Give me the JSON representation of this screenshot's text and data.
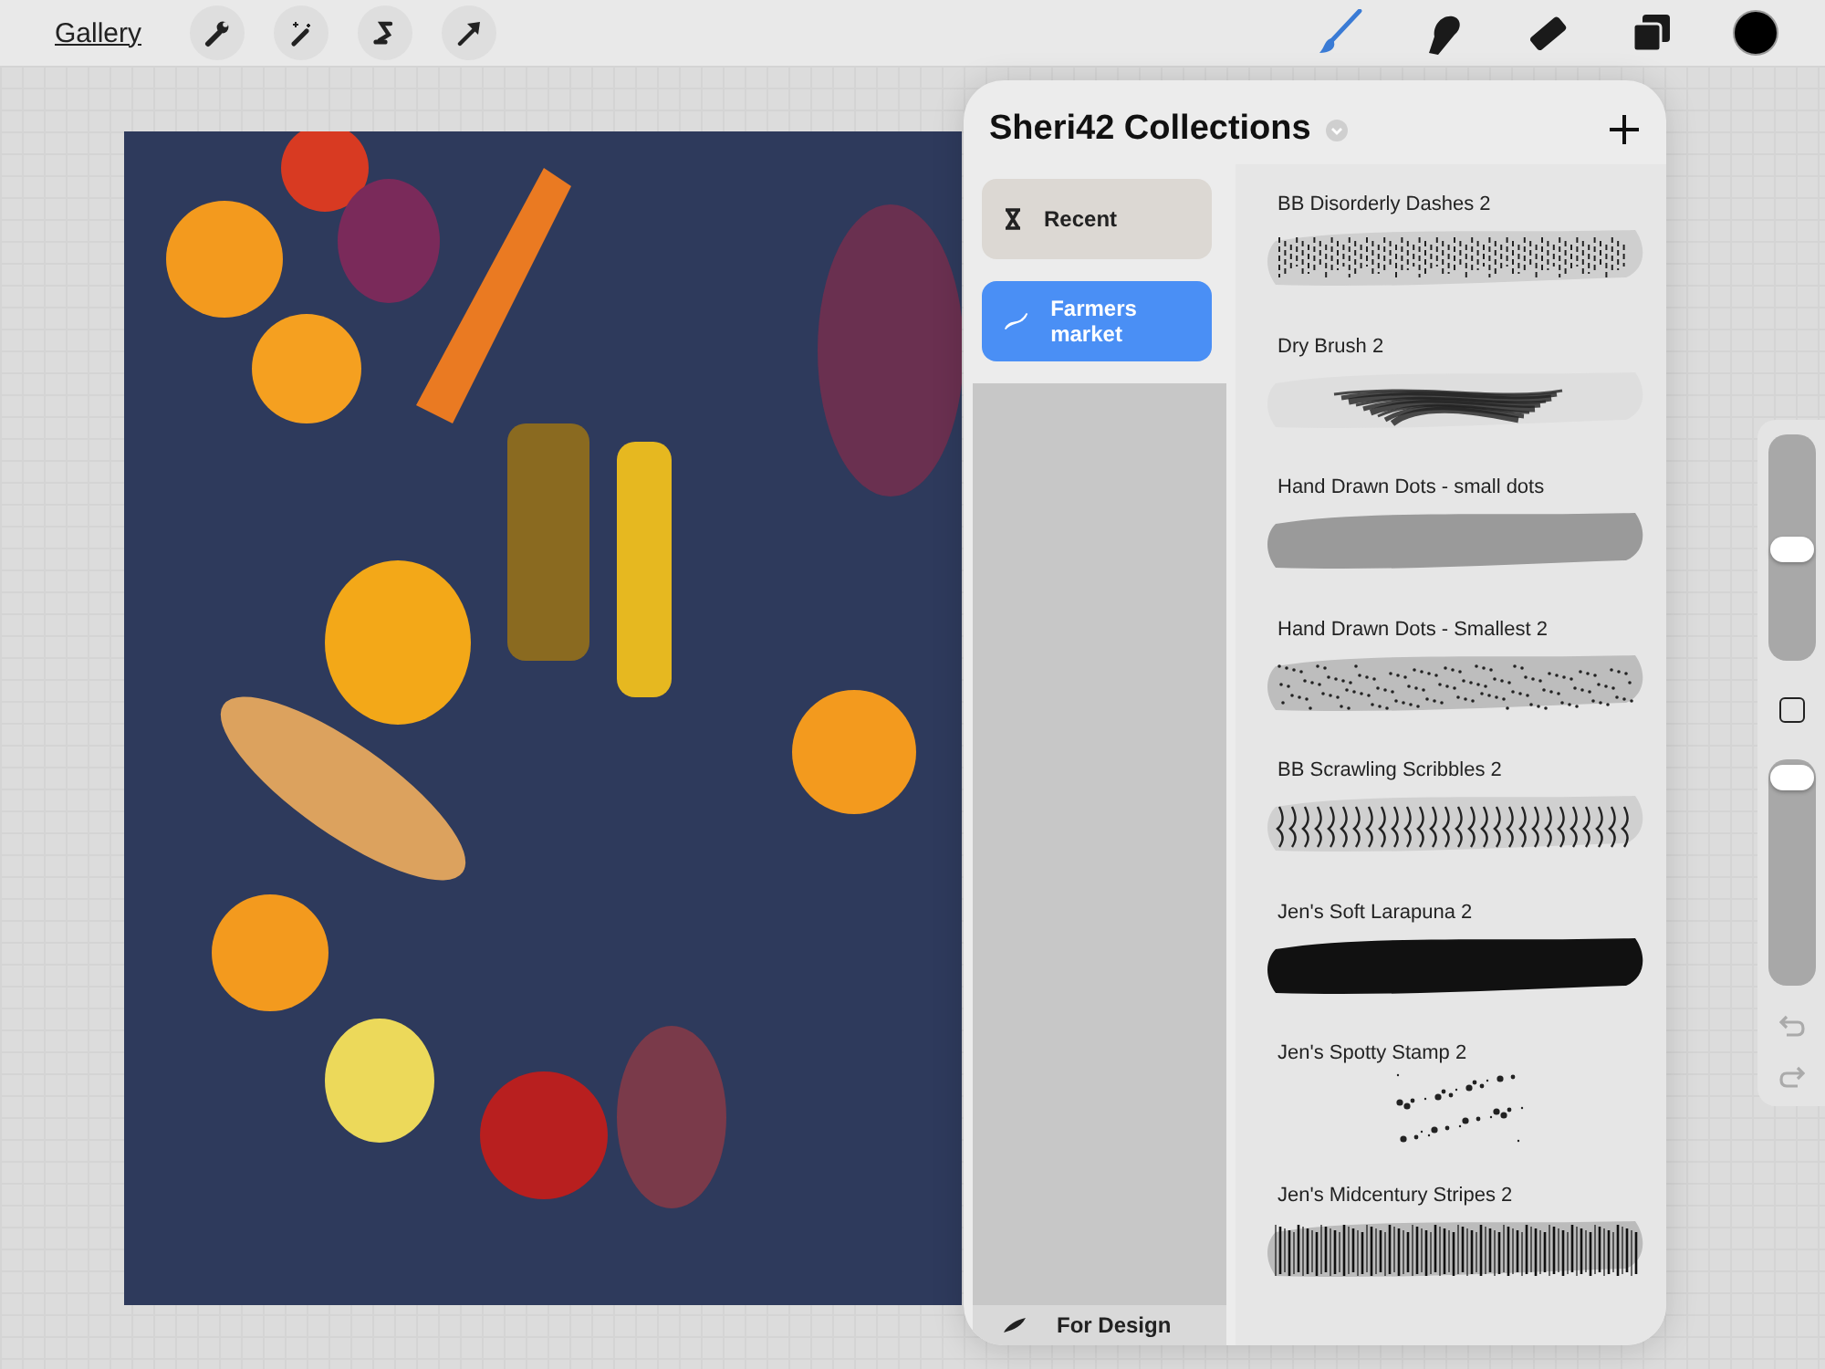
{
  "toolbar": {
    "gallery_link": "Gallery",
    "left_tools": [
      {
        "kind": "wrench"
      },
      {
        "kind": "wand"
      },
      {
        "kind": "selection"
      },
      {
        "kind": "arrow"
      }
    ],
    "right_tools": [
      {
        "kind": "brush",
        "selected": true
      },
      {
        "kind": "smudge",
        "selected": false
      },
      {
        "kind": "eraser",
        "selected": false
      },
      {
        "kind": "layers",
        "selected": false
      },
      {
        "kind": "color",
        "selected": false
      }
    ]
  },
  "brush_library": {
    "title": "Sheri42 Collections",
    "collections": [
      {
        "label": "Recent",
        "kind": "hourglass",
        "selected": false
      },
      {
        "label": "Farmers market",
        "kind": "stroke",
        "selected": true
      },
      {
        "label": "For Design",
        "kind": "leaf",
        "selected": false
      }
    ],
    "brushes": [
      {
        "name": "BB  Disorderly Dashes 2",
        "kind": "dashes"
      },
      {
        "name": "Dry Brush 2",
        "kind": "dry"
      },
      {
        "name": "Hand Drawn Dots - small dots",
        "kind": "dots"
      },
      {
        "name": "Hand Drawn Dots - Smallest 2",
        "kind": "stipple"
      },
      {
        "name": "BB  Scrawling Scribbles 2",
        "kind": "scribble"
      },
      {
        "name": "Jen's Soft Larapuna 2",
        "kind": "soft"
      },
      {
        "name": "Jen's Spotty Stamp 2",
        "kind": "spotty"
      },
      {
        "name": "Jen's Midcentury Stripes 2",
        "kind": "stripes"
      }
    ]
  },
  "side_controls": {
    "size": {
      "level": 0.49
    },
    "opacity": {
      "level": 0.92
    }
  }
}
